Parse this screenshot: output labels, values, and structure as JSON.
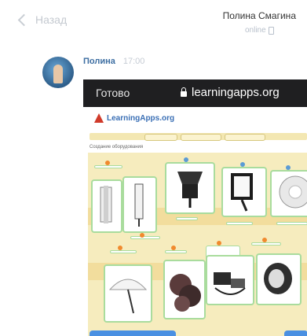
{
  "header": {
    "back_label": "Назад",
    "contact_name": "Полина Смагина",
    "contact_status": "online"
  },
  "message": {
    "sender": "Полина",
    "time": "17:00"
  },
  "screenshot": {
    "done_label": "Готово",
    "url": "learningapps.org",
    "site_logo": "LearningApps.org",
    "task_text": "Создание оборудования"
  },
  "colors": {
    "accent": "#3d6ea2",
    "browser_bar": "#1f1f21",
    "card_border": "#a9dc9d",
    "board_bg": "#f6ecbe"
  },
  "icons": [
    "chevron-left-icon",
    "phone-icon",
    "lock-icon"
  ]
}
